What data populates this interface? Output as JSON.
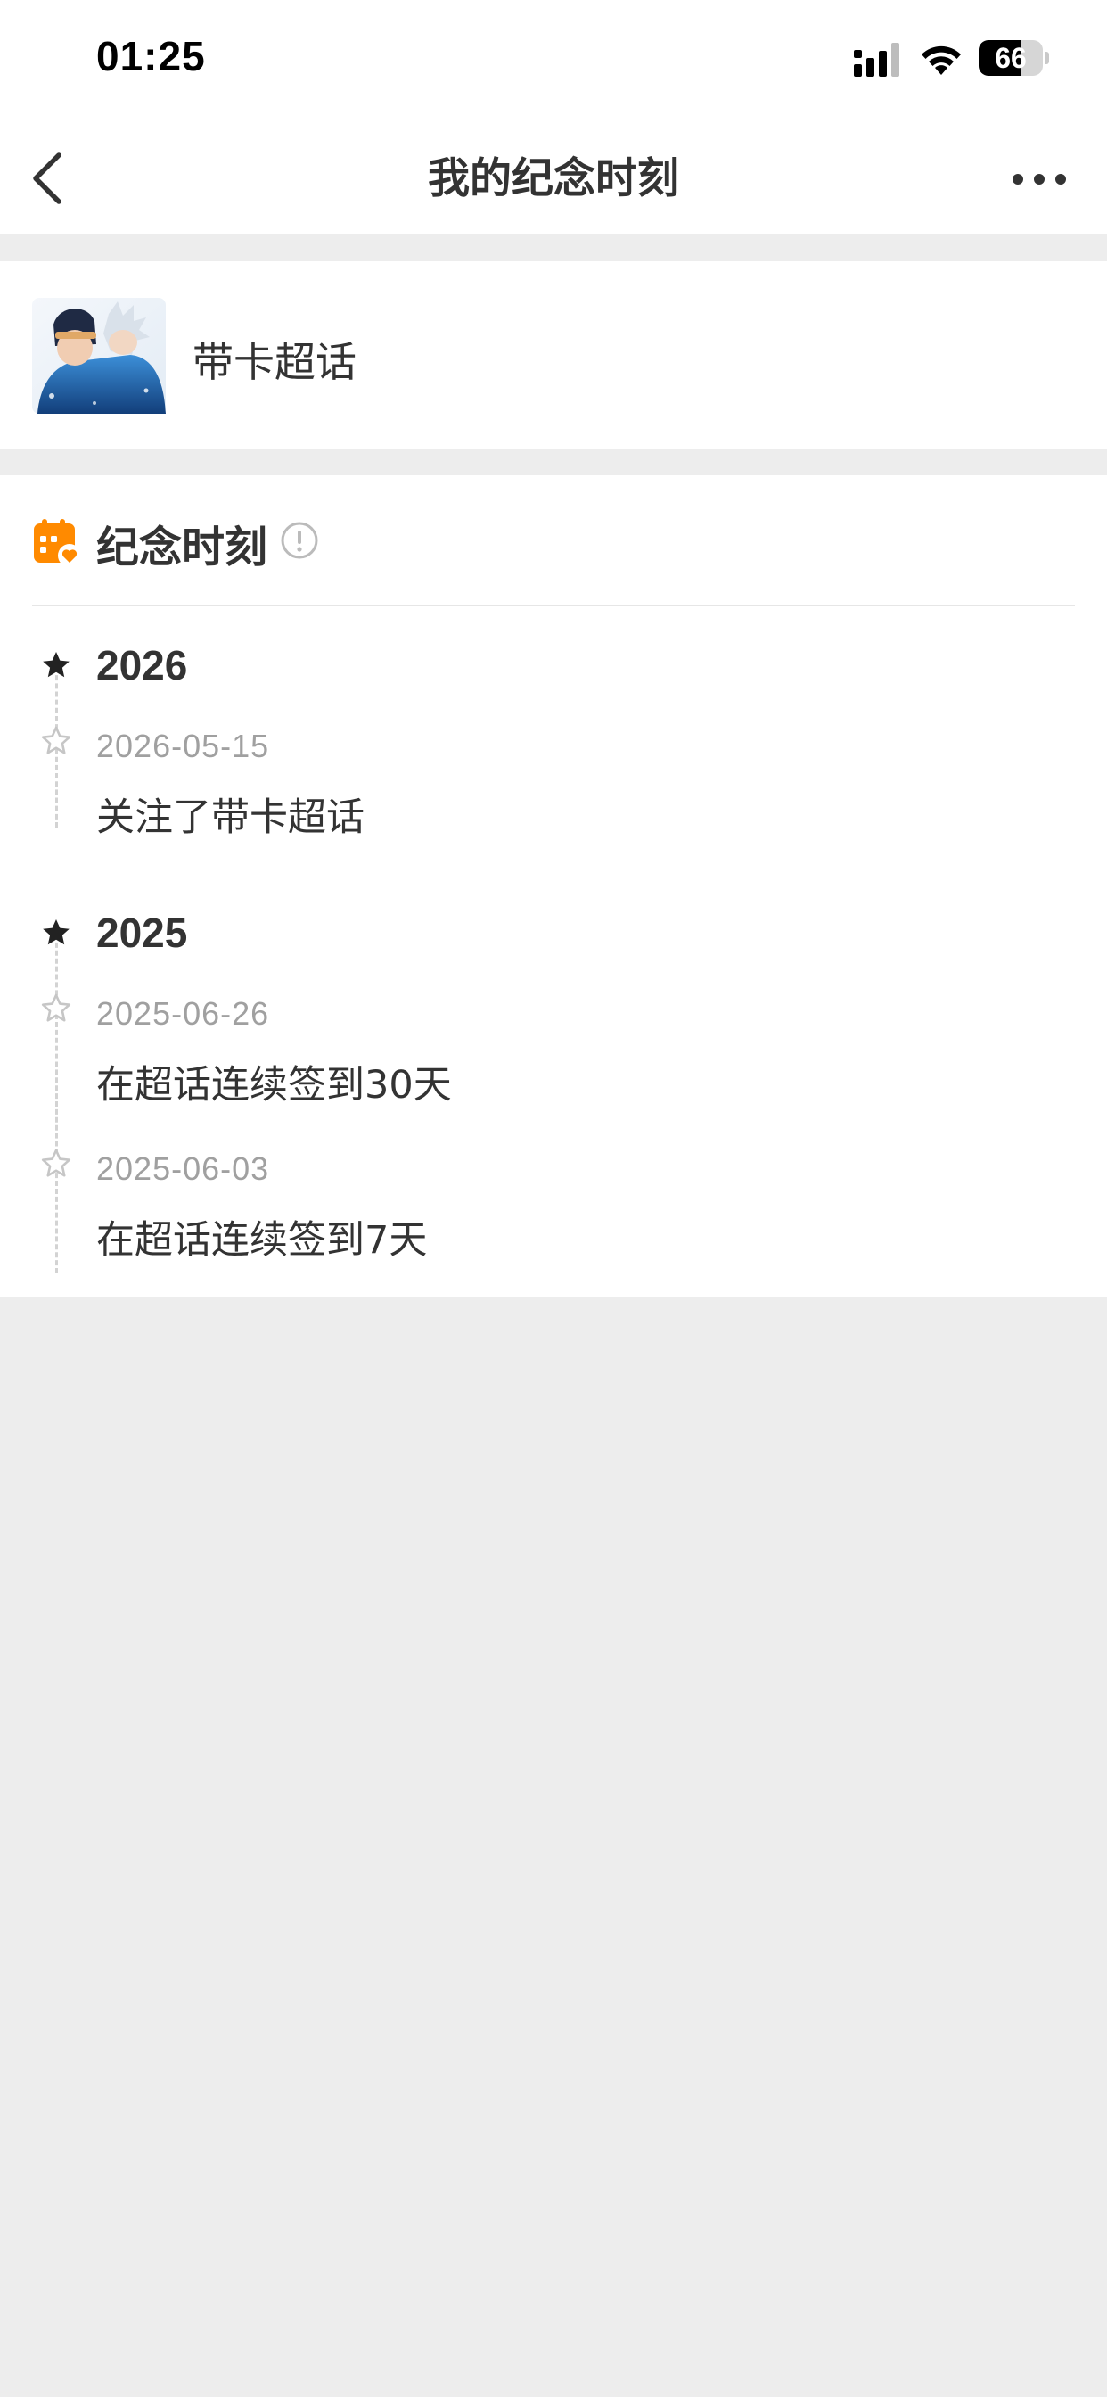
{
  "status_bar": {
    "time": "01:25",
    "battery_level": "66",
    "battery_fraction": 0.66
  },
  "nav": {
    "title": "我的纪念时刻"
  },
  "topic": {
    "name": "带卡超话"
  },
  "moments": {
    "section_title": "纪念时刻",
    "accent_color": "#FF8A00",
    "groups": [
      {
        "year": "2026",
        "entries": [
          {
            "date": "2026-05-15",
            "text": "关注了带卡超话"
          }
        ]
      },
      {
        "year": "2025",
        "entries": [
          {
            "date": "2025-06-26",
            "text": "在超话连续签到30天"
          },
          {
            "date": "2025-06-03",
            "text": "在超话连续签到7天"
          }
        ]
      }
    ]
  }
}
